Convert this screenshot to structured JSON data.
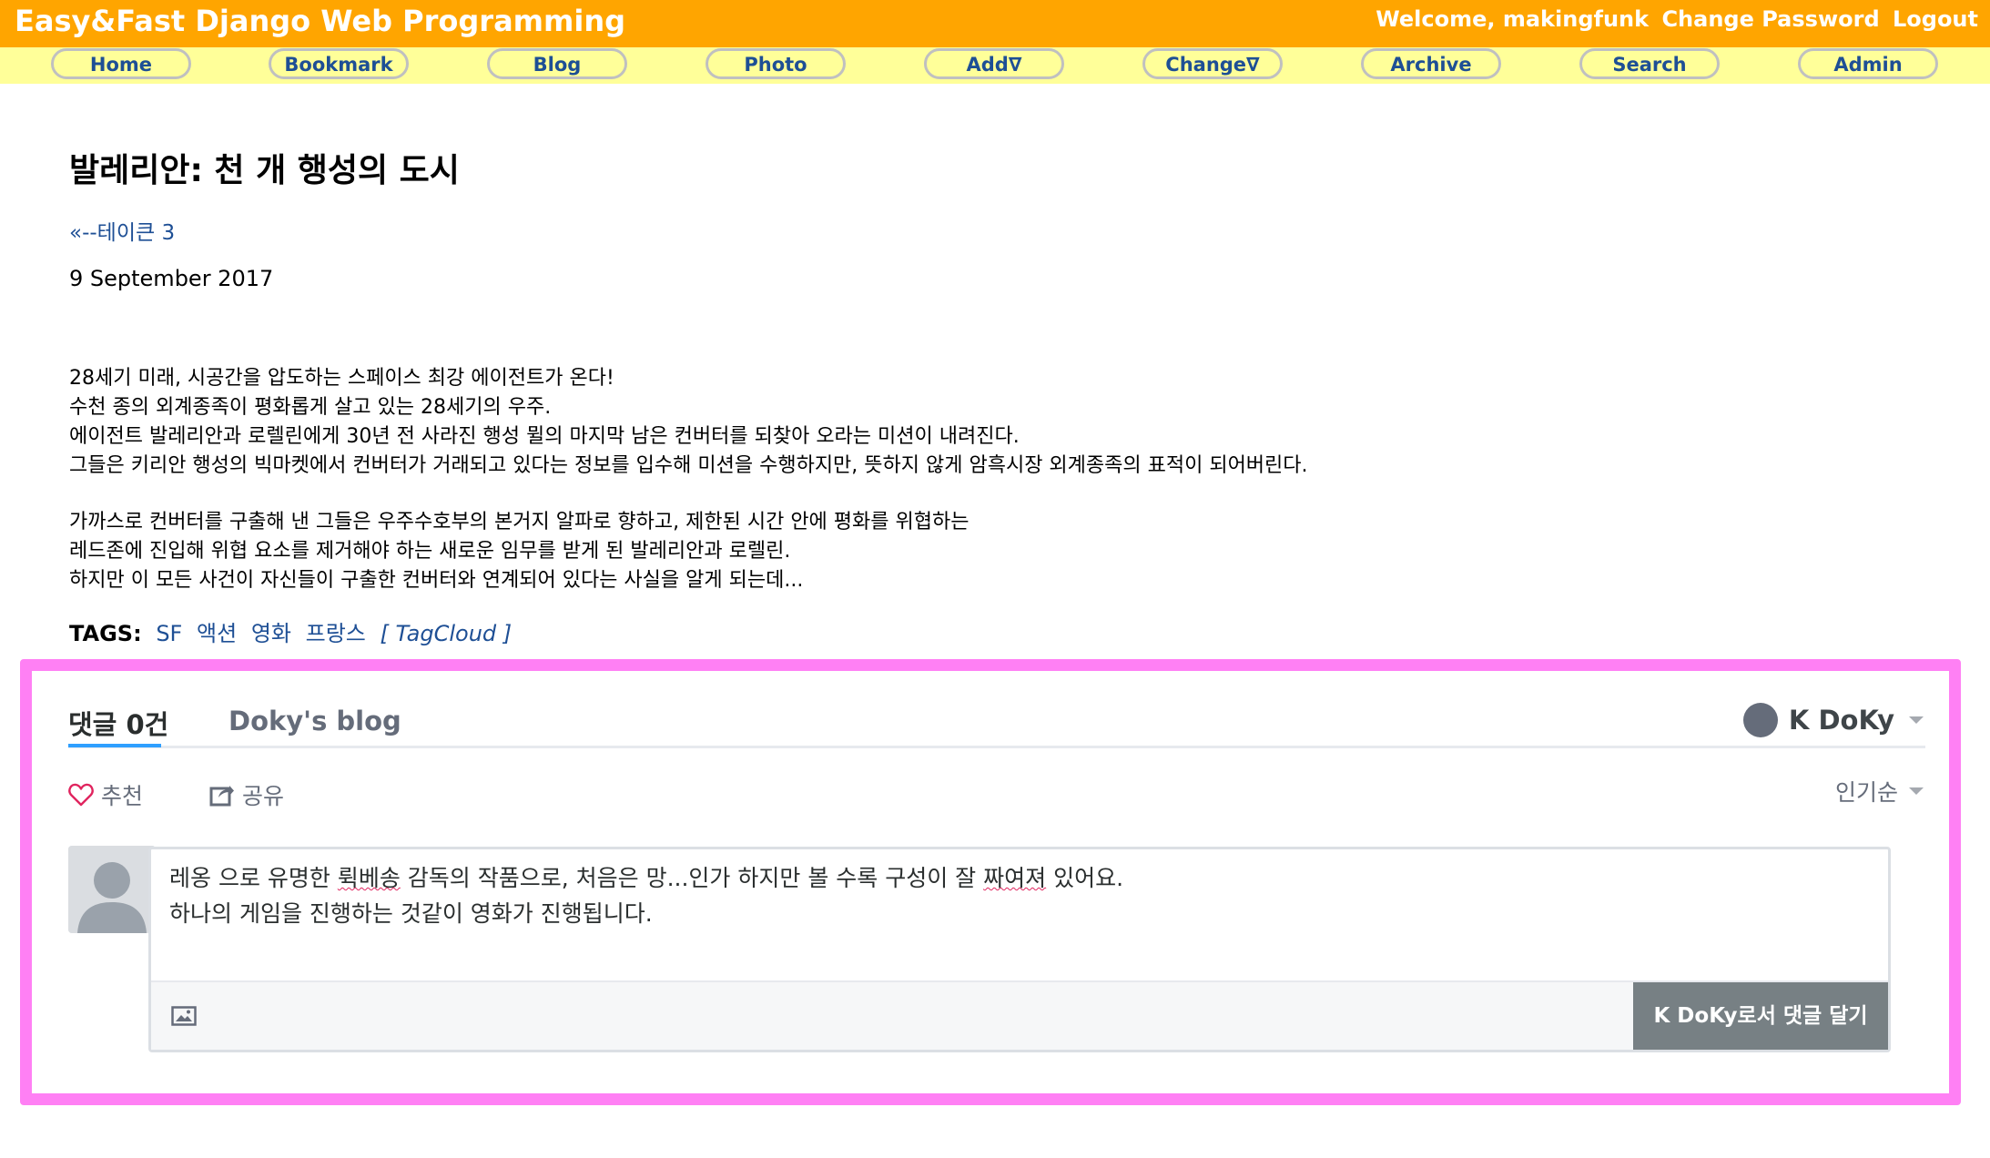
{
  "header": {
    "site_title": "Easy&Fast Django Web Programming",
    "welcome": "Welcome, makingfunk",
    "change_password": "Change Password",
    "logout": "Logout",
    "bg_color": "#FFA500"
  },
  "nav": {
    "items": [
      "Home",
      "Bookmark",
      "Blog",
      "Photo",
      "Add∇",
      "Change∇",
      "Archive",
      "Search",
      "Admin"
    ],
    "bg_color": "#FFFF99",
    "text_color": "#1E4F95"
  },
  "post": {
    "title": "발레리안: 천 개 행성의 도시",
    "prev_link": "«--테이큰 3",
    "date": "9 September 2017",
    "paragraph1": [
      "28세기 미래, 시공간을 압도하는 스페이스 최강 에이전트가 온다!",
      "수천 종의 외계종족이 평화롭게 살고 있는 28세기의 우주.",
      "에이전트 발레리안과 로렐린에게 30년 전 사라진 행성 뮐의 마지막 남은 컨버터를 되찾아 오라는 미션이 내려진다.",
      "그들은 키리안 행성의 빅마켓에서 컨버터가 거래되고 있다는 정보를 입수해 미션을 수행하지만, 뜻하지 않게 암흑시장 외계종족의 표적이 되어버린다."
    ],
    "paragraph2": [
      "가까스로 컨버터를 구출해 낸 그들은 우주수호부의 본거지 알파로 향하고, 제한된 시간 안에 평화를 위협하는",
      "레드존에 진입해 위협 요소를 제거해야 하는 새로운 임무를 받게 된 발레리안과 로렐린.",
      "하지만 이 모든 사건이 자신들이 구출한 컨버터와 연계되어 있다는 사실을 알게 되는데..."
    ],
    "tags_label": "TAGS:",
    "tags": [
      "SF",
      "액션",
      "영화",
      "프랑스"
    ],
    "tagcloud": "[ TagCloud ]"
  },
  "comments": {
    "count_tab": "댓글 0건",
    "community_tab": "Doky's blog",
    "user_name": "K DoKy",
    "recommend": "추천",
    "share": "공유",
    "sort": "인기순",
    "draft_line1_a": "레옹 으로 유명한 ",
    "draft_line1_b": "뤽베송",
    "draft_line1_c": " 감독의 작품으로, 처음은 망...인가 하지만 볼 수록 구성이 잘 ",
    "draft_line1_d": "짜여져",
    "draft_line1_e": " 있어요.",
    "draft_line2": "하나의 게임을 진행하는 것같이 영화가 진행됩니다.",
    "post_button": "K DoKy로서 댓글 달기",
    "highlight_color": "#FF80F4",
    "accent_color": "#2e9fff"
  }
}
